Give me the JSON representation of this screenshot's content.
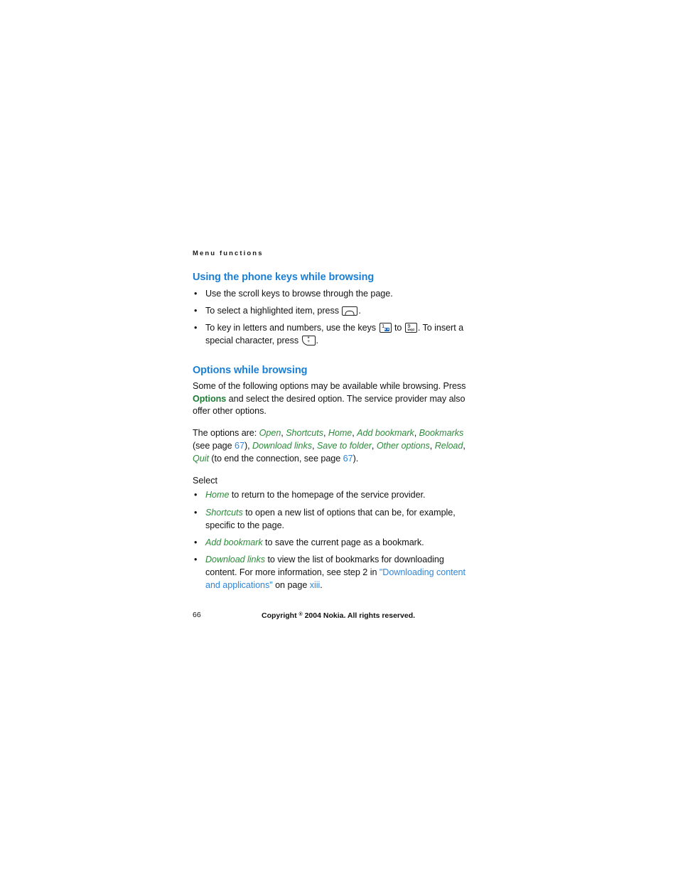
{
  "document": {
    "running_head": "Menu functions",
    "page_number": "66",
    "copyright_prefix": "Copyright ",
    "copyright_symbol": "®",
    "copyright_suffix": " 2004 Nokia. All rights reserved."
  },
  "colors": {
    "heading_blue": "#1a7fd4",
    "link_blue": "#2f86d8",
    "option_green": "#2e8b3c",
    "bold_green": "#1e7a33",
    "body_black": "#121212"
  },
  "sections": [
    {
      "heading": "Using the phone keys while browsing",
      "bullets": [
        {
          "parts": [
            {
              "type": "text",
              "value": "Use the scroll keys to browse through the page."
            }
          ]
        },
        {
          "parts": [
            {
              "type": "text",
              "value": "To select a highlighted item, press "
            },
            {
              "type": "key",
              "key": "softkey-left"
            },
            {
              "type": "text",
              "value": "."
            }
          ]
        },
        {
          "parts": [
            {
              "type": "text",
              "value": "To key in letters and numbers, use the keys "
            },
            {
              "type": "key",
              "key": "key-1",
              "label": "1",
              "sub": ""
            },
            {
              "type": "text",
              "value": " to "
            },
            {
              "type": "key",
              "key": "key-9",
              "label": "9",
              "sub": "wxyz"
            },
            {
              "type": "text",
              "value": ". To insert a special character, press "
            },
            {
              "type": "key",
              "key": "key-star",
              "label": "*",
              "sub": "+"
            },
            {
              "type": "text",
              "value": "."
            }
          ]
        }
      ]
    },
    {
      "heading": "Options while browsing",
      "paragraph_1": {
        "before_options": "Some of the following options may be available while browsing. Press ",
        "options_bold": "Options",
        "after_options": " and select the desired option. The service provider may also offer other options."
      },
      "paragraph_2": {
        "intro": "The options are: ",
        "option_list_1": [
          "Open",
          "Shortcuts",
          "Home",
          "Add bookmark",
          "Bookmarks"
        ],
        "see_page_text_1": " (see page ",
        "page_ref_1": "67",
        "mid_text": "), ",
        "option_list_2": [
          "Download links",
          "Save to folder",
          "Other options",
          "Reload",
          "Quit"
        ],
        "tail_text": " (to end the connection, see page ",
        "page_ref_2": "67",
        "close_text": ")."
      },
      "select_label": "Select",
      "select_bullets": [
        {
          "option": "Home",
          "text": " to return to the homepage of the service provider."
        },
        {
          "option": "Shortcuts",
          "text": " to open a new list of options that can be, for example, specific to the page."
        },
        {
          "option": "Add bookmark",
          "text": " to save the current page as a bookmark."
        },
        {
          "option": "Download links",
          "text_before_link": " to view the list of bookmarks for downloading content. For more information, see step 2 in ",
          "link_text": "\"Downloading content and applications\"",
          "text_mid": " on page ",
          "page_ref": "xiii",
          "text_after": "."
        }
      ]
    }
  ]
}
